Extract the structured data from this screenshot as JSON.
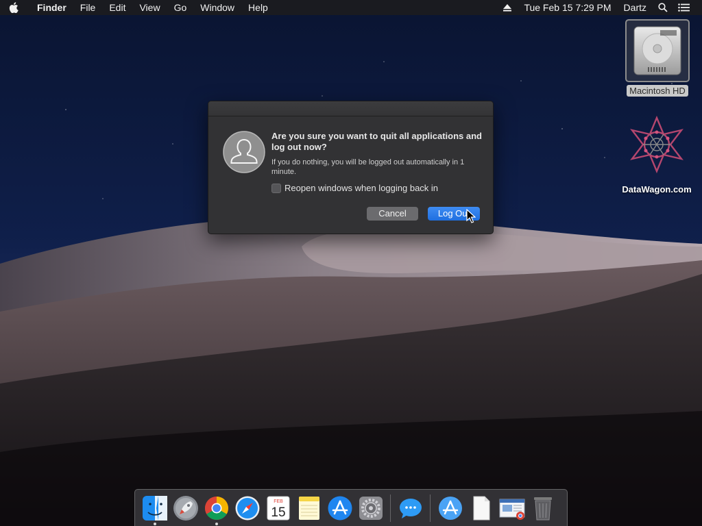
{
  "menubar": {
    "apple_icon": "apple-logo-icon",
    "app_name": "Finder",
    "menus": [
      "File",
      "Edit",
      "View",
      "Go",
      "Window",
      "Help"
    ],
    "datetime": "Tue Feb 15  7:29 PM",
    "user": "Dartz",
    "status_icons": [
      "eject-icon",
      "spotlight-search-icon",
      "notification-center-icon"
    ]
  },
  "desktop": {
    "icons": [
      {
        "label": "Macintosh HD",
        "icon": "hard-drive-icon",
        "selected": true
      },
      {
        "label": "DataWagon.com",
        "icon": "datawagon-logo-icon",
        "selected": false
      }
    ]
  },
  "dialog": {
    "avatar_icon": "user-silhouette-icon",
    "title": "Are you sure you want to quit all applications and log out now?",
    "info": "If you do nothing, you will be logged out automatically in 1 minute.",
    "checkbox_label": "Reopen windows when logging back in",
    "checkbox_checked": false,
    "cancel_label": "Cancel",
    "logout_label": "Log Out",
    "default_button_color": "#1f6fe0"
  },
  "dock": {
    "items": [
      {
        "name": "Finder",
        "icon": "finder-icon",
        "running": true
      },
      {
        "name": "Launchpad",
        "icon": "launchpad-icon",
        "running": false
      },
      {
        "name": "Google Chrome",
        "icon": "chrome-icon",
        "running": true
      },
      {
        "name": "Safari",
        "icon": "safari-icon",
        "running": false
      },
      {
        "name": "Calendar",
        "icon": "calendar-icon",
        "running": false,
        "month": "FEB",
        "day": "15"
      },
      {
        "name": "Notes",
        "icon": "notes-icon",
        "running": false
      },
      {
        "name": "App Store",
        "icon": "app-store-icon",
        "running": false
      },
      {
        "name": "System Preferences",
        "icon": "system-preferences-icon",
        "running": false
      },
      {
        "name": "Messages",
        "icon": "messages-icon",
        "running": false
      },
      {
        "name": "Applications",
        "icon": "applications-folder-icon",
        "running": false
      },
      {
        "name": "Document",
        "icon": "document-icon",
        "running": false
      },
      {
        "name": "Downloads",
        "icon": "downloads-stack-icon",
        "running": false
      },
      {
        "name": "Trash",
        "icon": "trash-icon",
        "running": false
      }
    ]
  }
}
